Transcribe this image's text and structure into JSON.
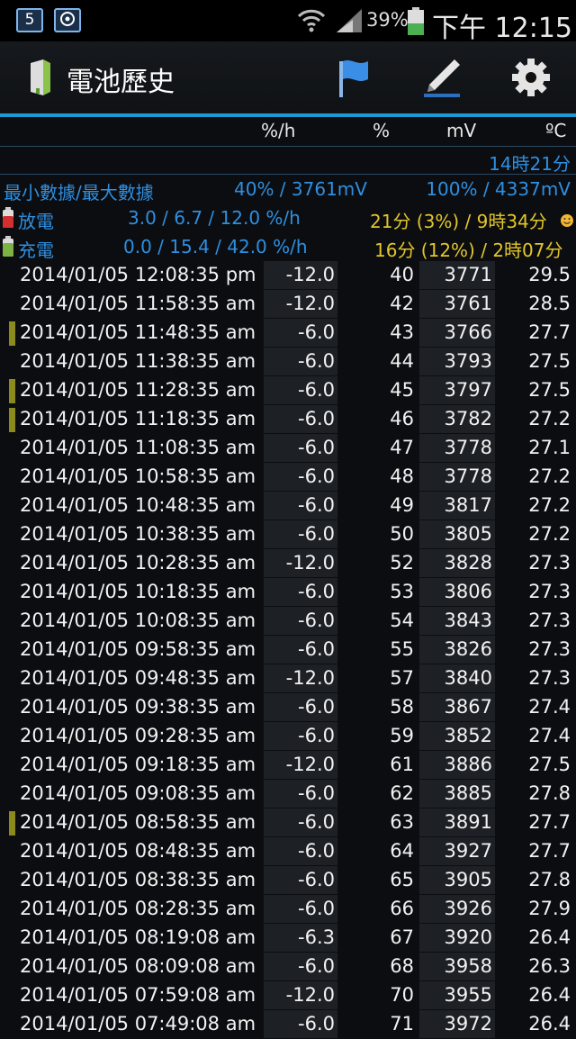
{
  "status_bar": {
    "notif1": "5",
    "battery_pct": "39%",
    "time": "下午 12:15"
  },
  "app": {
    "title": "電池歷史",
    "icons": [
      "battery-door-icon",
      "flag-icon",
      "pen-icon",
      "gear-icon"
    ]
  },
  "columns": {
    "rate": "%/h",
    "pct": "%",
    "mv": "mV",
    "temp": "ºC"
  },
  "summary": {
    "total_time": "14時21分",
    "minmax_label": "最小數據/最大數據",
    "min": "40% / 3761mV",
    "max": "100% / 4337mV",
    "discharge_label": "放電",
    "discharge_rates": "3.0 / 6.7 / 12.0 %/h",
    "discharge_time": "21分 (3%) / 9時34分",
    "charge_label": "充電",
    "charge_rates": "0.0 / 15.4 / 42.0 %/h",
    "charge_time": "16分 (12%) / 2時07分"
  },
  "colors": {
    "accent": "#1d9ad6",
    "blue_text": "#2f8fe0",
    "yellow_text": "#e3c62a",
    "marker": "#8b8a1c"
  },
  "rows": [
    {
      "date": "2014/01/05 12:08:35 pm",
      "rate": "-12.0",
      "pct": "40",
      "mv": "3771",
      "temp": "29.5",
      "marker": false
    },
    {
      "date": "2014/01/05 11:58:35 am",
      "rate": "-12.0",
      "pct": "42",
      "mv": "3761",
      "temp": "28.5",
      "marker": false
    },
    {
      "date": "2014/01/05 11:48:35 am",
      "rate": "-6.0",
      "pct": "43",
      "mv": "3766",
      "temp": "27.7",
      "marker": true
    },
    {
      "date": "2014/01/05 11:38:35 am",
      "rate": "-6.0",
      "pct": "44",
      "mv": "3793",
      "temp": "27.5",
      "marker": false
    },
    {
      "date": "2014/01/05 11:28:35 am",
      "rate": "-6.0",
      "pct": "45",
      "mv": "3797",
      "temp": "27.5",
      "marker": true
    },
    {
      "date": "2014/01/05 11:18:35 am",
      "rate": "-6.0",
      "pct": "46",
      "mv": "3782",
      "temp": "27.2",
      "marker": true
    },
    {
      "date": "2014/01/05 11:08:35 am",
      "rate": "-6.0",
      "pct": "47",
      "mv": "3778",
      "temp": "27.1",
      "marker": false
    },
    {
      "date": "2014/01/05 10:58:35 am",
      "rate": "-6.0",
      "pct": "48",
      "mv": "3778",
      "temp": "27.2",
      "marker": false
    },
    {
      "date": "2014/01/05 10:48:35 am",
      "rate": "-6.0",
      "pct": "49",
      "mv": "3817",
      "temp": "27.2",
      "marker": false
    },
    {
      "date": "2014/01/05 10:38:35 am",
      "rate": "-6.0",
      "pct": "50",
      "mv": "3805",
      "temp": "27.2",
      "marker": false
    },
    {
      "date": "2014/01/05 10:28:35 am",
      "rate": "-12.0",
      "pct": "52",
      "mv": "3828",
      "temp": "27.3",
      "marker": false
    },
    {
      "date": "2014/01/05 10:18:35 am",
      "rate": "-6.0",
      "pct": "53",
      "mv": "3806",
      "temp": "27.3",
      "marker": false
    },
    {
      "date": "2014/01/05 10:08:35 am",
      "rate": "-6.0",
      "pct": "54",
      "mv": "3843",
      "temp": "27.3",
      "marker": false
    },
    {
      "date": "2014/01/05 09:58:35 am",
      "rate": "-6.0",
      "pct": "55",
      "mv": "3826",
      "temp": "27.3",
      "marker": false
    },
    {
      "date": "2014/01/05 09:48:35 am",
      "rate": "-12.0",
      "pct": "57",
      "mv": "3840",
      "temp": "27.3",
      "marker": false
    },
    {
      "date": "2014/01/05 09:38:35 am",
      "rate": "-6.0",
      "pct": "58",
      "mv": "3867",
      "temp": "27.4",
      "marker": false
    },
    {
      "date": "2014/01/05 09:28:35 am",
      "rate": "-6.0",
      "pct": "59",
      "mv": "3852",
      "temp": "27.4",
      "marker": false
    },
    {
      "date": "2014/01/05 09:18:35 am",
      "rate": "-12.0",
      "pct": "61",
      "mv": "3886",
      "temp": "27.5",
      "marker": false
    },
    {
      "date": "2014/01/05 09:08:35 am",
      "rate": "-6.0",
      "pct": "62",
      "mv": "3885",
      "temp": "27.8",
      "marker": false
    },
    {
      "date": "2014/01/05 08:58:35 am",
      "rate": "-6.0",
      "pct": "63",
      "mv": "3891",
      "temp": "27.7",
      "marker": true
    },
    {
      "date": "2014/01/05 08:48:35 am",
      "rate": "-6.0",
      "pct": "64",
      "mv": "3927",
      "temp": "27.7",
      "marker": false
    },
    {
      "date": "2014/01/05 08:38:35 am",
      "rate": "-6.0",
      "pct": "65",
      "mv": "3905",
      "temp": "27.8",
      "marker": false
    },
    {
      "date": "2014/01/05 08:28:35 am",
      "rate": "-6.0",
      "pct": "66",
      "mv": "3926",
      "temp": "27.9",
      "marker": false
    },
    {
      "date": "2014/01/05 08:19:08 am",
      "rate": "-6.3",
      "pct": "67",
      "mv": "3920",
      "temp": "26.4",
      "marker": false
    },
    {
      "date": "2014/01/05 08:09:08 am",
      "rate": "-6.0",
      "pct": "68",
      "mv": "3958",
      "temp": "26.3",
      "marker": false
    },
    {
      "date": "2014/01/05 07:59:08 am",
      "rate": "-12.0",
      "pct": "70",
      "mv": "3955",
      "temp": "26.4",
      "marker": false
    },
    {
      "date": "2014/01/05 07:49:08 am",
      "rate": "-6.0",
      "pct": "71",
      "mv": "3972",
      "temp": "26.4",
      "marker": false
    }
  ]
}
